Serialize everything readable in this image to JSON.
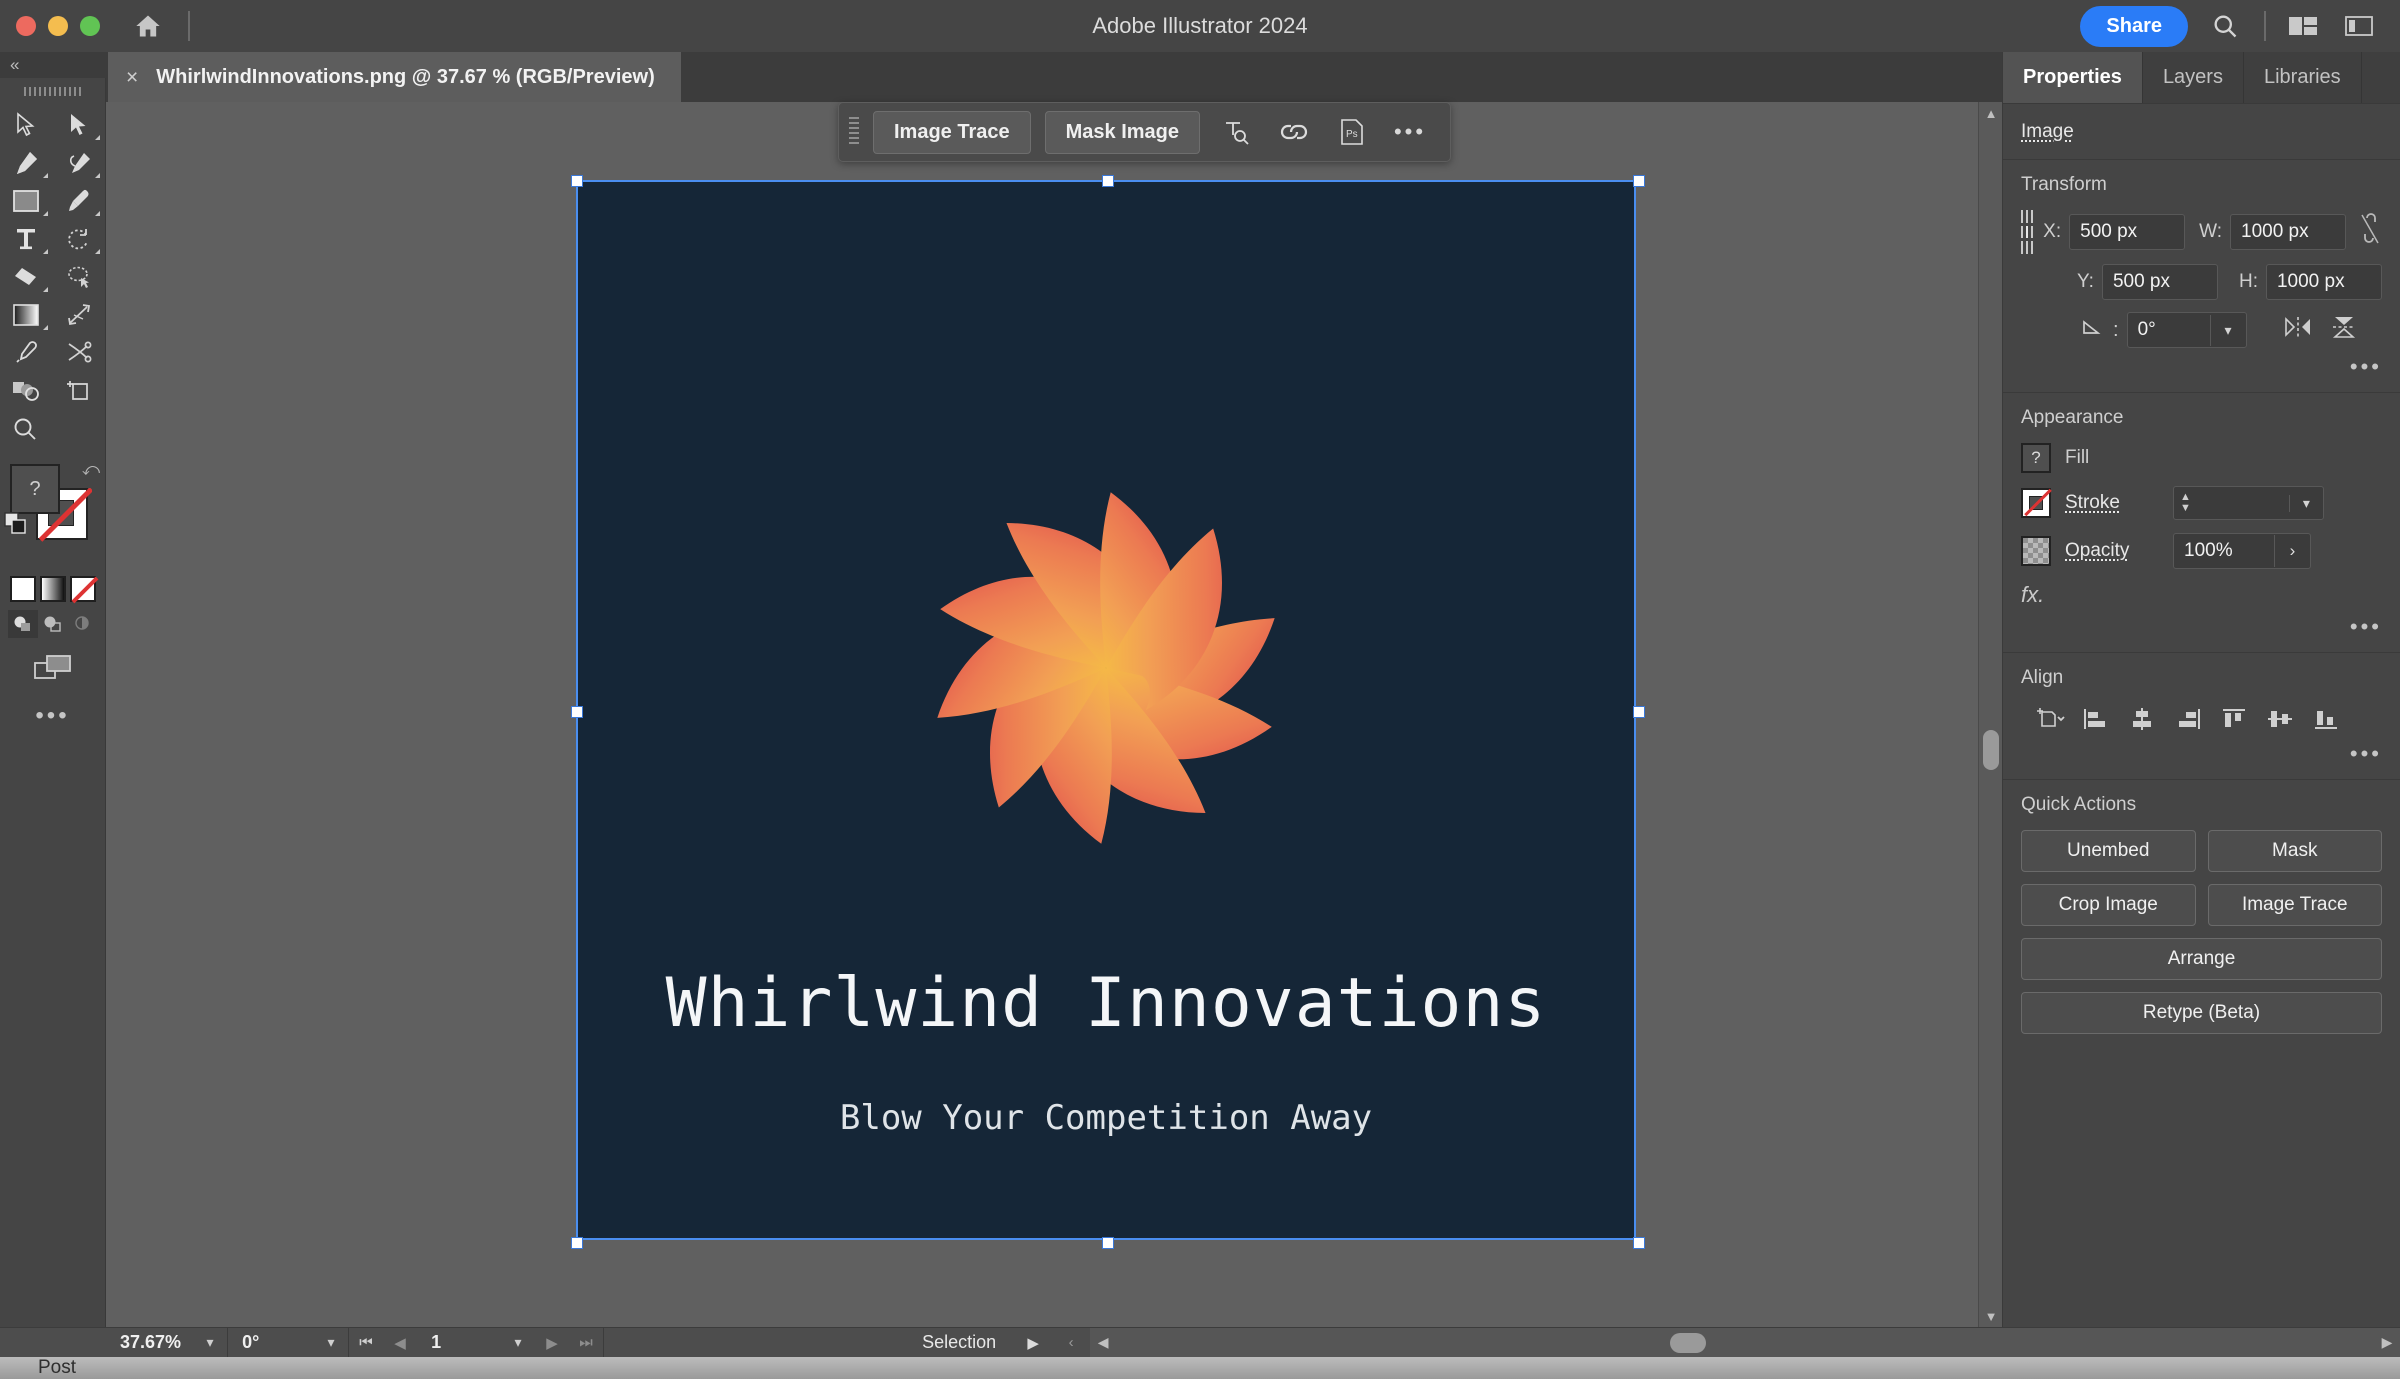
{
  "titlebar": {
    "app_title": "Adobe Illustrator 2024",
    "share_label": "Share",
    "home_icon": "home-icon",
    "search_icon": "search-icon",
    "arrange_icon": "arrange-documents-icon",
    "workspace_icon": "workspace-switcher-icon",
    "traffic": [
      "close",
      "minimize",
      "zoom"
    ]
  },
  "tabbar": {
    "collapse": "«",
    "close_glyph": "×",
    "doc_title": "WhirlwindInnovations.png @ 37.67 % (RGB/Preview)"
  },
  "toolbar": {
    "tools": [
      {
        "name": "selection-tool",
        "glyph": "selection"
      },
      {
        "name": "direct-selection-tool",
        "glyph": "direct-selection"
      },
      {
        "name": "pen-tool",
        "glyph": "pen"
      },
      {
        "name": "curvature-tool",
        "glyph": "curvature"
      },
      {
        "name": "rectangle-tool",
        "glyph": "rectangle"
      },
      {
        "name": "paintbrush-tool",
        "glyph": "paintbrush"
      },
      {
        "name": "type-tool",
        "glyph": "type"
      },
      {
        "name": "rotate-tool",
        "glyph": "rotate"
      },
      {
        "name": "eraser-tool",
        "glyph": "eraser"
      },
      {
        "name": "shaper-lasso-tool",
        "glyph": "lasso"
      },
      {
        "name": "gradient-tool",
        "glyph": "gradient"
      },
      {
        "name": "width-tool",
        "glyph": "width"
      },
      {
        "name": "eyedropper-tool",
        "glyph": "eyedropper"
      },
      {
        "name": "scissors-tool",
        "glyph": "scissors"
      },
      {
        "name": "shape-builder-tool",
        "glyph": "shape-builder"
      },
      {
        "name": "artboard-tool",
        "glyph": "artboard"
      },
      {
        "name": "zoom-tool",
        "glyph": "zoom"
      }
    ],
    "fill_label": "?",
    "more_dots": "•••"
  },
  "context_bar": {
    "image_trace_label": "Image Trace",
    "mask_image_label": "Mask Image",
    "icons": [
      "text-recognition-icon",
      "link-icon",
      "photoshop-icon",
      "more-options-icon"
    ],
    "more_dots": "•••"
  },
  "artwork": {
    "background_color": "#152637",
    "title": "Whirlwind Innovations",
    "subtitle": "Blow Your Competition Away",
    "logo_name": "whirlwind-pinwheel-logo",
    "blade_count": 10,
    "gradient": {
      "tip": "#E8604C",
      "mid": "#F2955A",
      "core": "#F7C93E"
    }
  },
  "properties": {
    "tabs": [
      {
        "label": "Properties",
        "active": true
      },
      {
        "label": "Layers",
        "active": false
      },
      {
        "label": "Libraries",
        "active": false
      }
    ],
    "object_type": "Image",
    "transform": {
      "heading": "Transform",
      "x_label": "X:",
      "x_value": "500 px",
      "y_label": "Y:",
      "y_value": "500 px",
      "w_label": "W:",
      "w_value": "1000 px",
      "h_label": "H:",
      "h_value": "1000 px",
      "angle_value": "0°",
      "link_icon": "unlinked-proportions-icon",
      "flip_h_icon": "flip-horizontal-icon",
      "flip_v_icon": "flip-vertical-icon",
      "more_dots": "•••"
    },
    "appearance": {
      "heading": "Appearance",
      "fill_label": "Fill",
      "fill_swatch": "unknown-fill-question-mark",
      "stroke_label": "Stroke",
      "stroke_value": "",
      "stroke_swatch": "no-stroke-swatch",
      "opacity_label": "Opacity",
      "opacity_value": "100%",
      "opacity_swatch": "transparency-checkerboard",
      "fx_label": "fx.",
      "more_dots": "•••"
    },
    "align": {
      "heading": "Align",
      "icons": [
        "align-to-selection-icon",
        "align-left-icon",
        "align-horizontal-center-icon",
        "align-right-icon",
        "align-top-icon",
        "align-vertical-center-icon",
        "align-bottom-icon"
      ],
      "more_dots": "•••"
    },
    "quick_actions": {
      "heading": "Quick Actions",
      "buttons": [
        {
          "label": "Unembed"
        },
        {
          "label": "Mask"
        },
        {
          "label": "Crop Image"
        },
        {
          "label": "Image Trace"
        },
        {
          "label": "Arrange"
        },
        {
          "label": "Retype (Beta)"
        }
      ]
    }
  },
  "statusbar": {
    "zoom_value": "37.67%",
    "rotation_value": "0°",
    "page_value": "1",
    "status_text": "Selection",
    "first_glyph": "⏮",
    "prev_glyph": "◀",
    "next_glyph": "▶",
    "last_glyph": "⏭",
    "caret": "⌄"
  },
  "bottom_strip": {
    "label": "Post"
  }
}
